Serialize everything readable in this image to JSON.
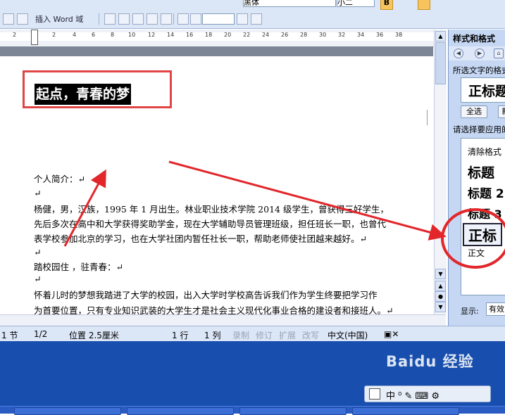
{
  "toolbar": {
    "insert_field_label": "插入 Word 域",
    "font_name": "黑体",
    "font_size": "小二",
    "bold_label": "B"
  },
  "ruler": {
    "ticks": [
      "2",
      "2",
      "4",
      "6",
      "8",
      "10",
      "12",
      "14",
      "16",
      "18",
      "20",
      "22",
      "24",
      "26",
      "28",
      "30",
      "32",
      "34",
      "36",
      "38"
    ]
  },
  "document": {
    "title": "起点，青春的梦",
    "lines": [
      "个人简介：↵",
      "↵",
      "   杨健，男，汉族，1995 年 1 月出生。林业职业技术学院 2014 级学生，曾获得三好学生，",
      "先后多次在高中和大学获得奖助学金，现在大学辅助导员管理班级，担任班长一职，也曾代",
      "表学校参加北京的学习，也在大学社团内暂任社长一职，帮助老师使社团越来越好。↵",
      "↵",
      "踏校园住 ，驻青春：↵",
      "↵",
      "   怀着儿时的梦想我踏进了大学的校园，出入大学时学校高告诉我们作为学生终要把学习作",
      "为首要位置，只有专业知识武装的大学生才是社会主义现代化事业合格的建设者和接班人。↵"
    ]
  },
  "status_bar": {
    "section": "1 节",
    "page": "1/2",
    "position": "位置 2.5厘米",
    "row": "1 行",
    "col": "1 列",
    "record": "录制",
    "revise": "修订",
    "extend": "扩展",
    "overwrite": "改写",
    "language": "中文(中国)"
  },
  "pane": {
    "title": "样式和格式",
    "selected_label": "所选文字的格式",
    "selected_format": "正标题",
    "select_all": "全选",
    "new_button": "新",
    "apply_label": "请选择要应用的格式",
    "styles": [
      "清除格式",
      "标题",
      "标题 2",
      "标题 3",
      "正标",
      "正文"
    ],
    "show_label": "显示:",
    "show_value": "有效"
  },
  "desktop": {
    "watermark": "Baidu 经验",
    "lang_bar": "中 ⁰ ✎ ⌨ ⚙"
  }
}
